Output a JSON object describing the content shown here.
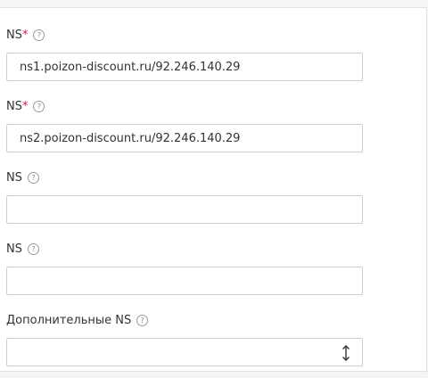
{
  "fields": [
    {
      "label": "NS",
      "required_mark": "*",
      "help": "?",
      "value": "ns1.poizon-discount.ru/92.246.140.29"
    },
    {
      "label": "NS",
      "required_mark": "*",
      "help": "?",
      "value": "ns2.poizon-discount.ru/92.246.140.29"
    },
    {
      "label": "NS",
      "required_mark": "",
      "help": "?",
      "value": ""
    },
    {
      "label": "NS",
      "required_mark": "",
      "help": "?",
      "value": ""
    }
  ],
  "extra": {
    "label": "Дополнительные NS",
    "help": "?",
    "value": ""
  },
  "colors": {
    "required": "#e0174a",
    "border": "#cfcfcf",
    "text": "#333333"
  },
  "icons": {
    "help": "help-circle-icon",
    "select": "up-down-arrow-icon"
  }
}
